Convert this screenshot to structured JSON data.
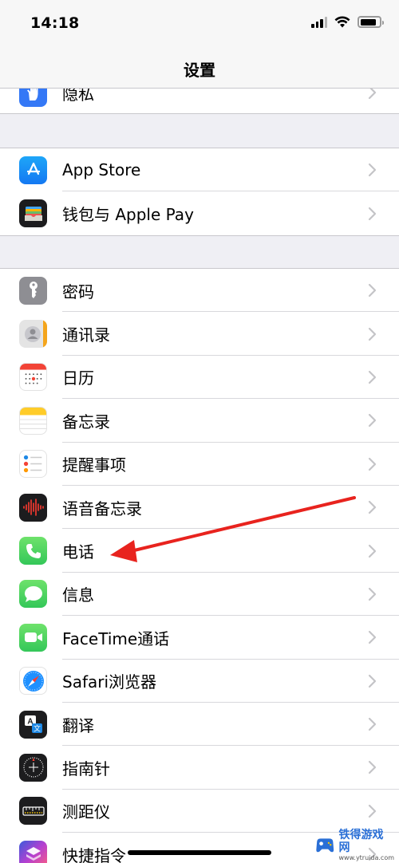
{
  "status": {
    "time": "14:18",
    "battery_level": 0.85
  },
  "nav": {
    "title": "设置"
  },
  "groups": [
    {
      "items": [
        {
          "label": "隐私",
          "icon": "hand-icon"
        }
      ]
    },
    {
      "items": [
        {
          "label": "App Store",
          "icon": "app-store-icon"
        },
        {
          "label": "钱包与 Apple Pay",
          "icon": "wallet-icon"
        }
      ]
    },
    {
      "items": [
        {
          "label": "密码",
          "icon": "key-icon"
        },
        {
          "label": "通讯录",
          "icon": "contacts-icon"
        },
        {
          "label": "日历",
          "icon": "calendar-icon"
        },
        {
          "label": "备忘录",
          "icon": "notes-icon"
        },
        {
          "label": "提醒事项",
          "icon": "reminders-icon"
        },
        {
          "label": "语音备忘录",
          "icon": "voice-memos-icon"
        },
        {
          "label": "电话",
          "icon": "phone-icon"
        },
        {
          "label": "信息",
          "icon": "messages-icon"
        },
        {
          "label": "FaceTime通话",
          "icon": "facetime-icon"
        },
        {
          "label": "Safari浏览器",
          "icon": "safari-icon"
        },
        {
          "label": "翻译",
          "icon": "translate-icon"
        },
        {
          "label": "指南针",
          "icon": "compass-icon"
        },
        {
          "label": "测距仪",
          "icon": "measure-icon"
        },
        {
          "label": "快捷指令",
          "icon": "shortcuts-icon"
        }
      ]
    }
  ],
  "watermark": {
    "name": "铁得游戏网",
    "url": "www.ytruida.com"
  },
  "colors": {
    "arrow": "#e8231e",
    "accent": "#2a6fd6"
  }
}
